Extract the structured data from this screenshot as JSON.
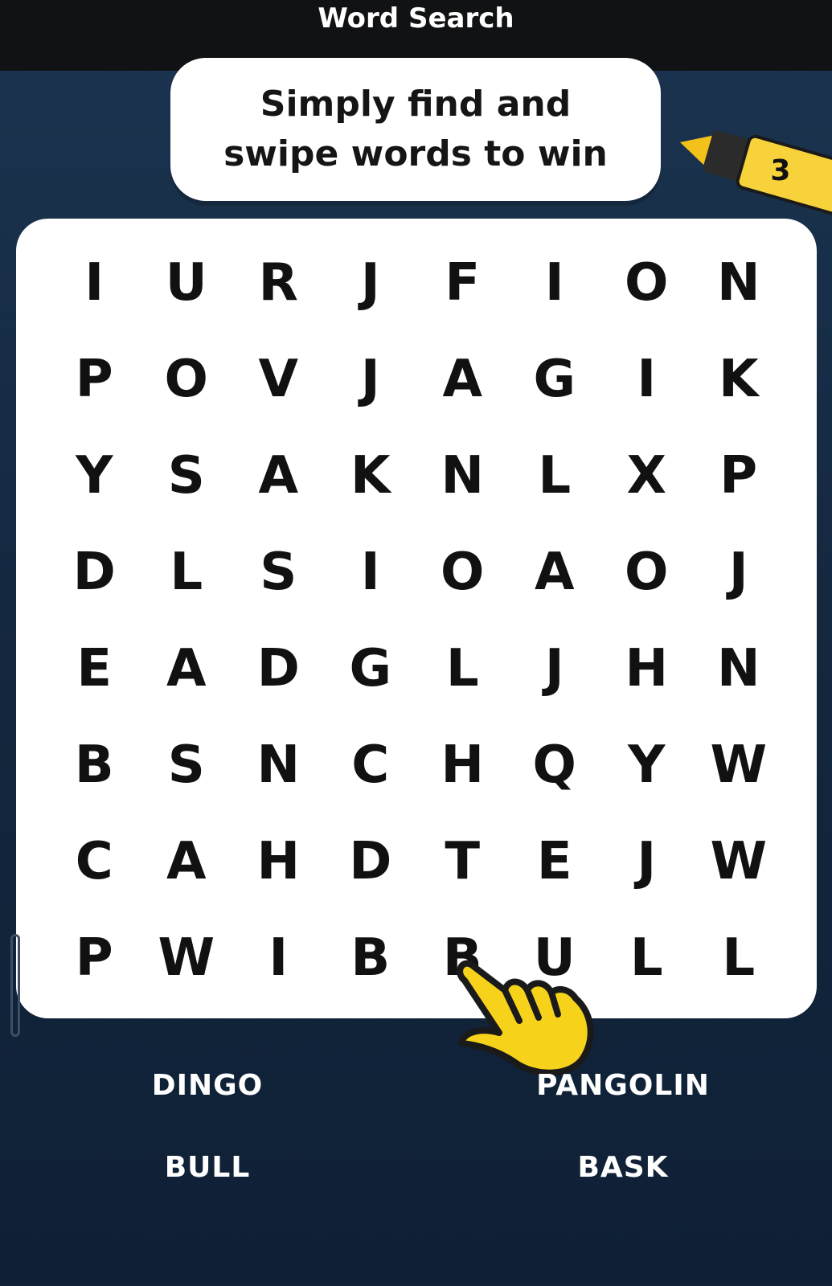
{
  "app": {
    "title": "Word Search"
  },
  "banner": {
    "text": "Simply find and\nswipe words to win"
  },
  "hint_marker": {
    "count": "3",
    "icon": "highlighter-icon",
    "color": "#f7d23a"
  },
  "grid": {
    "rows": [
      [
        "I",
        "U",
        "R",
        "J",
        "F",
        "I",
        "O",
        "N"
      ],
      [
        "P",
        "O",
        "V",
        "J",
        "A",
        "G",
        "I",
        "K"
      ],
      [
        "Y",
        "S",
        "A",
        "K",
        "N",
        "L",
        "X",
        "P"
      ],
      [
        "D",
        "L",
        "S",
        "I",
        "O",
        "A",
        "O",
        "J"
      ],
      [
        "E",
        "A",
        "D",
        "G",
        "L",
        "J",
        "H",
        "N"
      ],
      [
        "B",
        "S",
        "N",
        "C",
        "H",
        "Q",
        "Y",
        "W"
      ],
      [
        "C",
        "A",
        "H",
        "D",
        "T",
        "E",
        "J",
        "W"
      ],
      [
        "P",
        "W",
        "I",
        "B",
        "B",
        "U",
        "L",
        "L"
      ]
    ]
  },
  "words": [
    "DINGO",
    "PANGOLIN",
    "BULL",
    "BASK"
  ],
  "pointer": {
    "icon": "pointing-hand-icon",
    "color": "#f6d21b"
  }
}
